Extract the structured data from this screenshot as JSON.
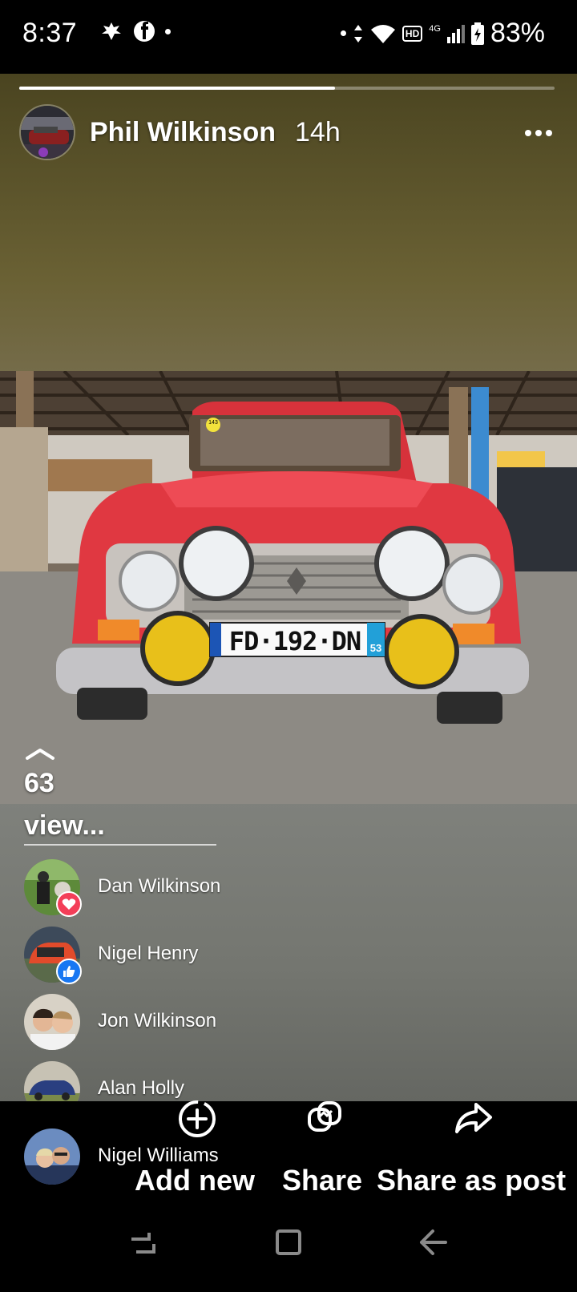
{
  "status_bar": {
    "time": "8:37",
    "battery": "83%",
    "network": "4G",
    "hd_badge": "HD",
    "icons": [
      "notification-icon",
      "facebook-icon",
      "wifi-icon",
      "signal-icon",
      "battery-icon"
    ]
  },
  "story": {
    "author": "Phil Wilkinson",
    "time_ago": "14h",
    "progress": 0.59,
    "photo": {
      "plate_text": "FD·192·DN",
      "plate_region": "53",
      "sticker": "143"
    }
  },
  "viewers": {
    "count": "63",
    "label": "view...",
    "list": [
      {
        "name": "Dan Wilkinson",
        "reaction": "love"
      },
      {
        "name": "Nigel Henry",
        "reaction": "like"
      },
      {
        "name": "Jon Wilkinson",
        "reaction": ""
      },
      {
        "name": "Alan Holly",
        "reaction": ""
      },
      {
        "name": "Nigel Williams",
        "reaction": ""
      }
    ]
  },
  "actions": {
    "add_new": "Add new",
    "share": "Share",
    "share_as_post": "Share as post"
  },
  "colors": {
    "love": "#f33e58",
    "like": "#1877f2"
  }
}
